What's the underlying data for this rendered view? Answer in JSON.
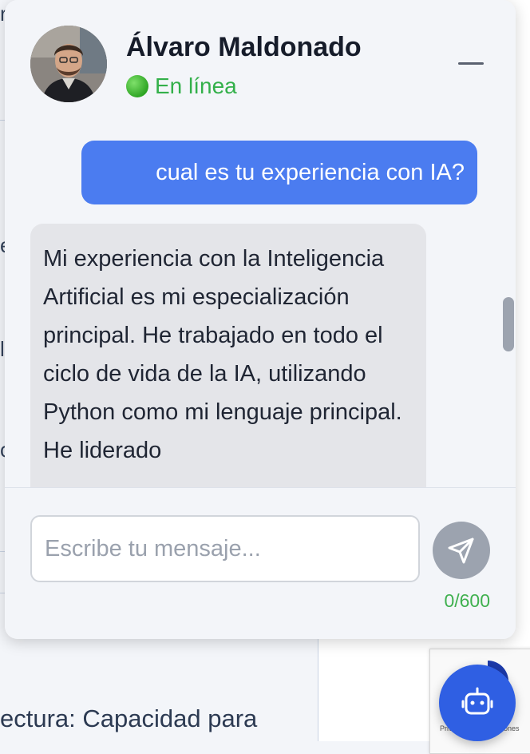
{
  "chat": {
    "agent_name": "Álvaro Maldonado",
    "status_text": "En línea",
    "messages": [
      {
        "role": "user",
        "text": "cual es tu experiencia con IA?"
      },
      {
        "role": "bot",
        "text": "Mi experiencia con la Inteligencia Artificial es mi especialización principal. He trabajado en todo el ciclo de vida de la IA, utilizando Python como mi lenguaje principal. He liderado"
      }
    ],
    "input_placeholder": "Escribe tu mensaje...",
    "input_value": "",
    "char_counter": "0/600",
    "send_icon": "send-icon",
    "minimize_icon": "minimize-icon"
  },
  "background": {
    "bottom_text": "ectura:  Capacidad  para",
    "fragments": [
      "r",
      "e",
      "l",
      "o"
    ]
  },
  "recaptcha": {
    "text": "Privacidad - Condiciones"
  },
  "launcher": {
    "icon": "robot-icon"
  },
  "colors": {
    "user_bubble": "#4b7cf0",
    "bot_bubble": "#e4e5e9",
    "online": "#33b04a",
    "launcher": "#2f5fe3",
    "send_disabled": "#9ca3af"
  }
}
